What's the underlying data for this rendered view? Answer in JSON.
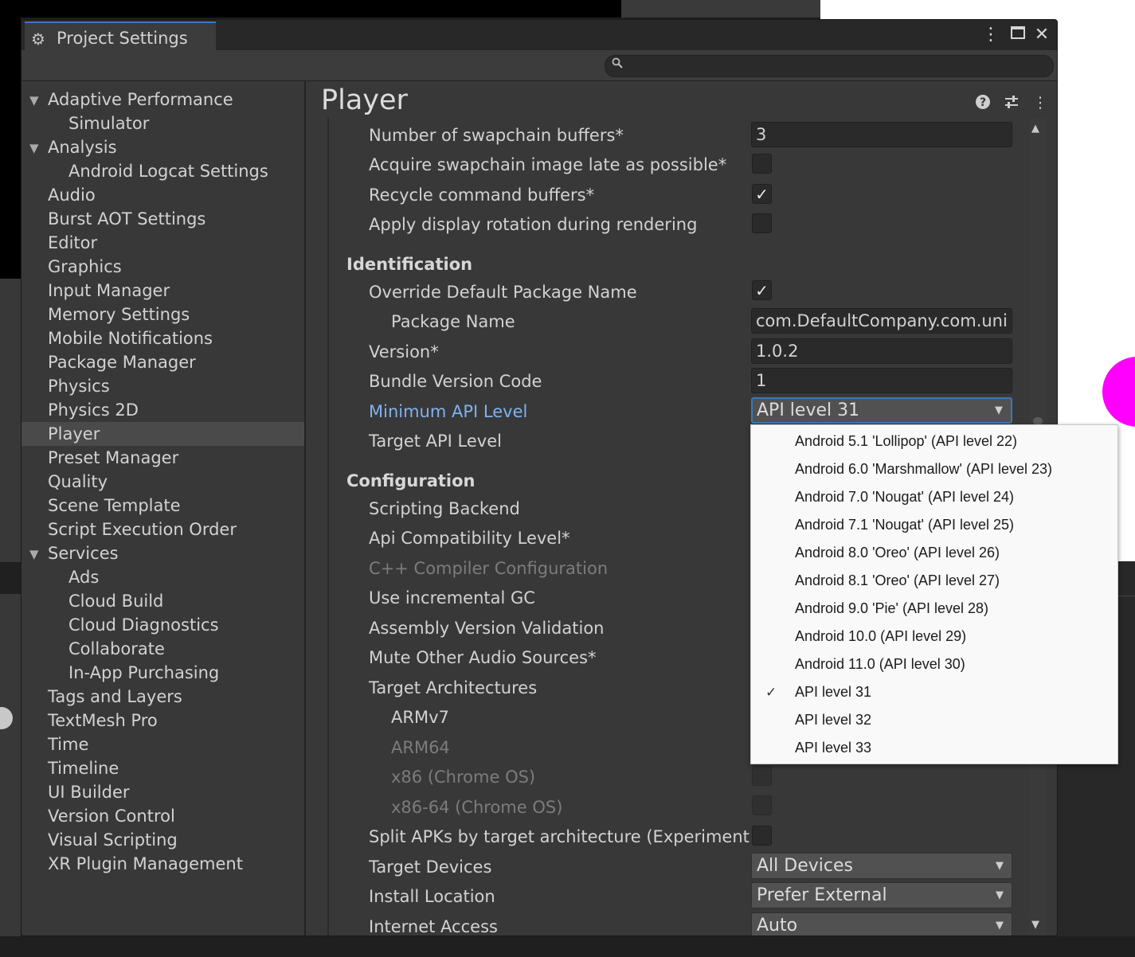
{
  "window": {
    "title": "Project Settings",
    "search": {
      "placeholder": "",
      "value": ""
    }
  },
  "sidebar": {
    "items": [
      {
        "label": "Adaptive Performance"
      },
      {
        "label": "Simulator"
      },
      {
        "label": "Analysis"
      },
      {
        "label": "Android Logcat Settings"
      },
      {
        "label": "Audio"
      },
      {
        "label": "Burst AOT Settings"
      },
      {
        "label": "Editor"
      },
      {
        "label": "Graphics"
      },
      {
        "label": "Input Manager"
      },
      {
        "label": "Memory Settings"
      },
      {
        "label": "Mobile Notifications"
      },
      {
        "label": "Package Manager"
      },
      {
        "label": "Physics"
      },
      {
        "label": "Physics 2D"
      },
      {
        "label": "Player"
      },
      {
        "label": "Preset Manager"
      },
      {
        "label": "Quality"
      },
      {
        "label": "Scene Template"
      },
      {
        "label": "Script Execution Order"
      },
      {
        "label": "Services"
      },
      {
        "label": "Ads"
      },
      {
        "label": "Cloud Build"
      },
      {
        "label": "Cloud Diagnostics"
      },
      {
        "label": "Collaborate"
      },
      {
        "label": "In-App Purchasing"
      },
      {
        "label": "Tags and Layers"
      },
      {
        "label": "TextMesh Pro"
      },
      {
        "label": "Time"
      },
      {
        "label": "Timeline"
      },
      {
        "label": "UI Builder"
      },
      {
        "label": "Version Control"
      },
      {
        "label": "Visual Scripting"
      },
      {
        "label": "XR Plugin Management"
      }
    ],
    "selected": "Player"
  },
  "main": {
    "title": "Player",
    "rows": {
      "swapchain_buffers": {
        "label": "Number of swapchain buffers*",
        "value": "3"
      },
      "acquire_late": {
        "label": "Acquire swapchain image late as possible*",
        "checked": false
      },
      "recycle_cmd": {
        "label": "Recycle command buffers*",
        "checked": true
      },
      "display_rotation": {
        "label": "Apply display rotation during rendering",
        "checked": false
      },
      "identification_header": "Identification",
      "override_package": {
        "label": "Override Default Package Name",
        "checked": true
      },
      "package_name": {
        "label": "Package Name",
        "value": "com.DefaultCompany.com.uni"
      },
      "version": {
        "label": "Version*",
        "value": "1.0.2"
      },
      "bundle_code": {
        "label": "Bundle Version Code",
        "value": "1"
      },
      "min_api": {
        "label": "Minimum API Level",
        "value": "API level 31"
      },
      "target_api": {
        "label": "Target API Level"
      },
      "configuration_header": "Configuration",
      "scripting_backend": {
        "label": "Scripting Backend"
      },
      "api_compat": {
        "label": "Api Compatibility Level*"
      },
      "cpp_compiler": {
        "label": "C++ Compiler Configuration"
      },
      "incremental_gc": {
        "label": "Use incremental GC"
      },
      "assembly_validation": {
        "label": "Assembly Version Validation"
      },
      "mute_audio": {
        "label": "Mute Other Audio Sources*"
      },
      "target_arch": {
        "label": "Target Architectures"
      },
      "armv7": {
        "label": "ARMv7"
      },
      "arm64": {
        "label": "ARM64"
      },
      "x86": {
        "label": "x86 (Chrome OS)",
        "checked": false
      },
      "x86_64": {
        "label": "x86-64 (Chrome OS)",
        "checked": false
      },
      "split_apks": {
        "label": "Split APKs by target architecture (Experiment",
        "checked": false
      },
      "target_devices": {
        "label": "Target Devices",
        "value": "All Devices"
      },
      "install_location": {
        "label": "Install Location",
        "value": "Prefer External"
      },
      "internet_access": {
        "label": "Internet Access",
        "value": "Auto"
      }
    }
  },
  "popup": {
    "selected": "API level 31",
    "options": [
      "Android 5.1 'Lollipop' (API level 22)",
      "Android 6.0 'Marshmallow' (API level 23)",
      "Android 7.0 'Nougat' (API level 24)",
      "Android 7.1 'Nougat' (API level 25)",
      "Android 8.0 'Oreo' (API level 26)",
      "Android 8.1 'Oreo' (API level 27)",
      "Android 9.0 'Pie' (API level 28)",
      "Android 10.0 (API level 29)",
      "Android 11.0 (API level 30)",
      "API level 31",
      "API level 32",
      "API level 33"
    ]
  },
  "icons": {
    "gear": "gear-icon",
    "kebab": "kebab-menu-icon",
    "maximize": "maximize-icon",
    "close": "close-icon",
    "search": "search-icon",
    "help": "help-icon",
    "presets": "presets-icon",
    "dropdown_arrow": "chevron-down-icon",
    "check": "check-icon"
  },
  "colors": {
    "accent": "#3a79bb",
    "highlight_label": "#7fb2f0",
    "panel_bg": "#383838",
    "popup_bg": "#f9f9f9",
    "scene_magenta": "#ff00ff"
  }
}
